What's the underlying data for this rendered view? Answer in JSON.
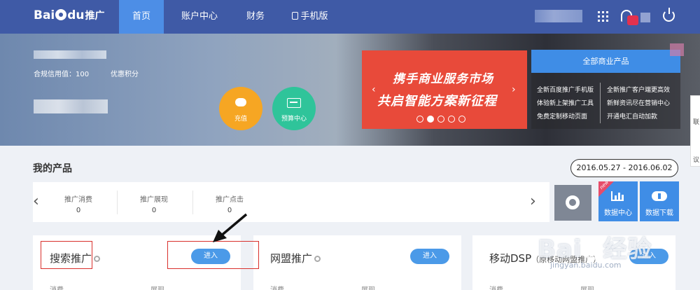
{
  "brand": {
    "logo_left": "Bai",
    "logo_right": "du",
    "logo_suffix": "推广"
  },
  "nav": [
    {
      "label": "首页",
      "active": true
    },
    {
      "label": "账户中心",
      "active": false
    },
    {
      "label": "财务",
      "active": false
    },
    {
      "label": "手机版",
      "active": false
    }
  ],
  "header_icons": [
    "apps-grid-icon",
    "bell-icon",
    "power-icon"
  ],
  "account": {
    "credit_label": "合规信用值：100",
    "points_label": "优惠积分"
  },
  "quick_actions": {
    "charge": "充值",
    "budget": "预算中心"
  },
  "promo": {
    "line1": "携手商业服务市场",
    "line2": "共启智能方案新征程",
    "slide_count": 5,
    "active_slide": 2
  },
  "products_panel": {
    "button": "全部商业产品",
    "links_left": [
      "全新百度推广手机版",
      "体验新上架推广工具",
      "免费定制移动页面"
    ],
    "links_right": [
      "全新推广客户端更高效",
      "新鲜资讯尽在营销中心",
      "开通电汇自动加款"
    ]
  },
  "side_tab": {
    "label1": "联",
    "label2": "议"
  },
  "section": {
    "title": "我的产品",
    "date_range": "2016.05.27 - 2016.06.02"
  },
  "stats": [
    {
      "label": "推广消费",
      "value": "0"
    },
    {
      "label": "推广展现",
      "value": "0"
    },
    {
      "label": "推广点击",
      "value": "0"
    }
  ],
  "tiles": {
    "new_badge": "new",
    "data_center": "数据中心",
    "download": "数据下载"
  },
  "cards": [
    {
      "name": "搜索推广",
      "enter": "进入",
      "sub_left": "消费",
      "sub_right": "展现"
    },
    {
      "name": "网盟推广",
      "enter": "进入",
      "sub_left": "消费",
      "sub_right": "展现"
    },
    {
      "name": "移动DSP",
      "sub_name": "（原移动网盟推广）",
      "enter": "进入",
      "sub_left": "消费",
      "sub_right": "展现"
    }
  ],
  "watermark": {
    "main_left": "Bai",
    "main_right": "经验",
    "sub": "jingyan.baidu.com"
  },
  "colors": {
    "nav_bg": "#3f5aa6",
    "nav_active": "#4d8ee6",
    "accent_blue": "#3f8de6",
    "charge_orange": "#f6a623",
    "budget_green": "#2fc49a",
    "promo_red": "#e84a3a",
    "annotation_red": "#d9302c"
  }
}
